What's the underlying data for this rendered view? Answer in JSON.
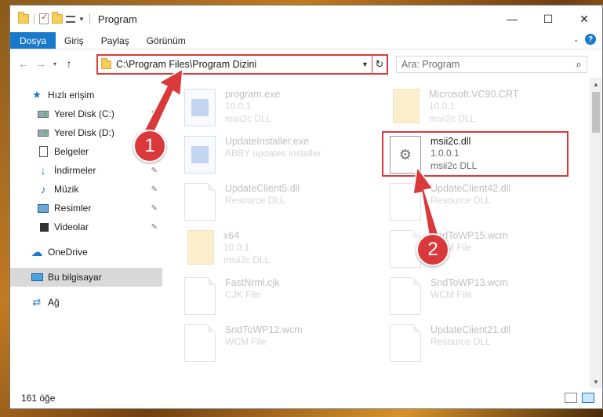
{
  "window": {
    "title": "Program",
    "controls": {
      "minimize": "—",
      "maximize": "☐",
      "close": "✕"
    }
  },
  "ribbon": {
    "tabs": [
      "Dosya",
      "Giriş",
      "Paylaş",
      "Görünüm"
    ]
  },
  "navbar": {
    "address": "C:\\Program Files\\Program Dizini",
    "search_placeholder": "Ara: Program"
  },
  "sidebar": {
    "items": [
      {
        "label": "Hızlı erişim",
        "icon": "star-icon"
      },
      {
        "label": "Yerel Disk (C:)",
        "icon": "disk-icon",
        "pinned": true
      },
      {
        "label": "Yerel Disk (D:)",
        "icon": "disk-icon",
        "pinned": true
      },
      {
        "label": "Belgeler",
        "icon": "document-icon",
        "pinned": true
      },
      {
        "label": "İndirmeler",
        "icon": "download-icon",
        "pinned": true
      },
      {
        "label": "Müzik",
        "icon": "music-icon",
        "pinned": true
      },
      {
        "label": "Resimler",
        "icon": "pictures-icon",
        "pinned": true
      },
      {
        "label": "Videolar",
        "icon": "videos-icon",
        "pinned": true
      },
      {
        "label": "OneDrive",
        "icon": "cloud-icon"
      },
      {
        "label": "Bu bilgisayar",
        "icon": "computer-icon",
        "selected": true
      },
      {
        "label": "Ağ",
        "icon": "network-icon"
      }
    ]
  },
  "files": [
    {
      "name": "program.exe",
      "line2": "10.0.1",
      "line3": "msii2c DLL",
      "type": "exe"
    },
    {
      "name": "Microsoft.VC90.CRT",
      "line2": "10.0.1",
      "line3": "msii2c DLL",
      "type": "folder"
    },
    {
      "name": "UpdateInstaller.exe",
      "line2": "ABBY updates installer",
      "line3": "",
      "type": "exe"
    },
    {
      "name": "msii2c.dll",
      "line2": "1.0.0.1",
      "line3": "msii2c DLL",
      "type": "dll",
      "highlighted": true
    },
    {
      "name": "UpdateClient5.dll",
      "line2": "Resource DLL",
      "line3": "",
      "type": "dll"
    },
    {
      "name": "UpdateClient42.dll",
      "line2": "Resource DLL",
      "line3": "",
      "type": "dll"
    },
    {
      "name": "x64",
      "line2": "10.0.1",
      "line3": "msii2c DLL",
      "type": "folder"
    },
    {
      "name": "SndToWP15.wcm",
      "line2": "WCM File",
      "line3": "",
      "type": "file"
    },
    {
      "name": "FastNrml.cjk",
      "line2": "CJK File",
      "line3": "",
      "type": "file"
    },
    {
      "name": "SndToWP13.wcm",
      "line2": "WCM File",
      "line3": "",
      "type": "file"
    },
    {
      "name": "SndToWP12.wcm",
      "line2": "WCM File",
      "line3": "",
      "type": "file"
    },
    {
      "name": "UpdateClient21.dll",
      "line2": "Resource DLL",
      "line3": "",
      "type": "dll"
    }
  ],
  "status": {
    "item_count": "161 öğe"
  },
  "annotations": {
    "badge1": "1",
    "badge2": "2"
  },
  "colors": {
    "accent": "#1979ca",
    "highlight": "#d9393b",
    "selected_nav": "#d9d9d9"
  }
}
